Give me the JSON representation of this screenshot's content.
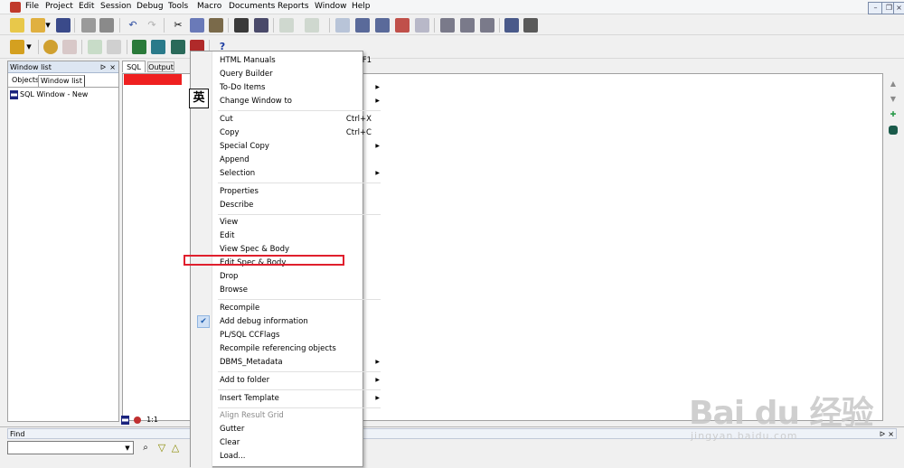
{
  "menubar": {
    "items": [
      "File",
      "Project",
      "Edit",
      "Session",
      "Debug",
      "Tools",
      "Macro",
      "Documents",
      "Reports",
      "Window",
      "Help"
    ]
  },
  "left_panel": {
    "title": "Window list",
    "pin": "ᐅ",
    "close": "×",
    "tabs": [
      "Objects",
      "Window list"
    ],
    "items": [
      "SQL Window - New"
    ]
  },
  "editor": {
    "tabs": [
      "SQL",
      "Output"
    ],
    "status_position": "1:1"
  },
  "find": {
    "title": "Find",
    "input_value": "",
    "pin": "ᐅ",
    "close": "×"
  },
  "ime_badge": "英",
  "context_menu": {
    "items": [
      {
        "label": "HTML Manuals",
        "shortcut": "F1"
      },
      {
        "label": "Query Builder"
      },
      {
        "label": "To-Do Items",
        "submenu": true
      },
      {
        "label": "Change Window to",
        "submenu": true
      },
      {
        "label": "Cut",
        "shortcut": "Ctrl+X"
      },
      {
        "label": "Copy",
        "shortcut": "Ctrl+C"
      },
      {
        "label": "Special Copy",
        "submenu": true
      },
      {
        "label": "Append"
      },
      {
        "label": "Selection",
        "submenu": true
      },
      {
        "label": "Properties"
      },
      {
        "label": "Describe"
      },
      {
        "label": "View"
      },
      {
        "label": "Edit"
      },
      {
        "label": "View Spec & Body"
      },
      {
        "label": "Edit Spec & Body"
      },
      {
        "label": "Drop"
      },
      {
        "label": "Browse"
      },
      {
        "label": "Recompile"
      },
      {
        "label": "Add debug information",
        "checked": true
      },
      {
        "label": "PL/SQL CCFlags"
      },
      {
        "label": "Recompile referencing objects"
      },
      {
        "label": "DBMS_Metadata",
        "submenu": true
      },
      {
        "label": "Add to folder",
        "submenu": true
      },
      {
        "label": "Insert Template",
        "submenu": true
      },
      {
        "label": "Align Result Grid",
        "disabled": true
      },
      {
        "label": "Gutter"
      },
      {
        "label": "Clear"
      },
      {
        "label": "Load..."
      }
    ]
  },
  "watermark": {
    "main": "Bai du 经验",
    "sub": "jingyan.baidu.com"
  },
  "colors": {
    "highlight": "#e01f2d",
    "red_bar": "#ef2020",
    "menu_bg": "#ffffff"
  }
}
